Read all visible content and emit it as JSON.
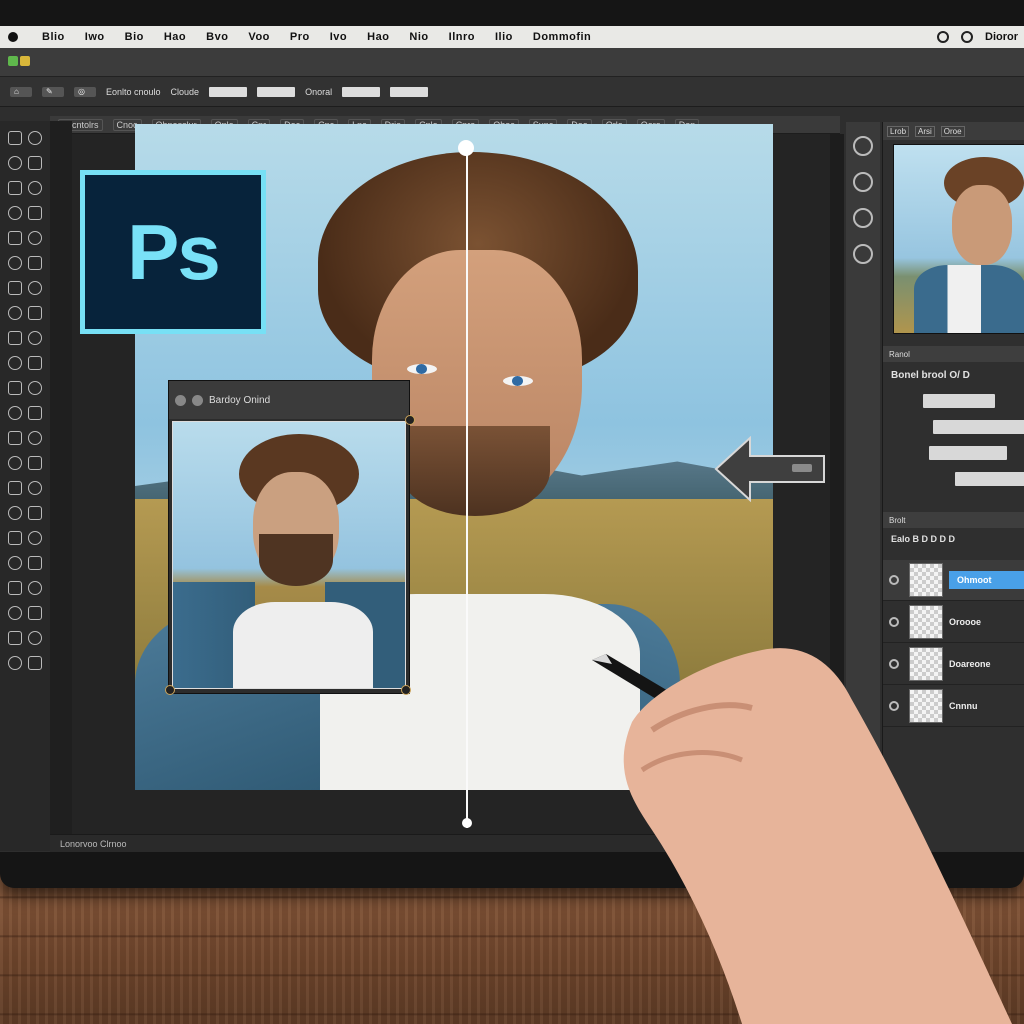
{
  "menubar": {
    "items": [
      "Blio",
      "Iwo",
      "Bio",
      "Hao",
      "Bvo",
      "Voo",
      "Pro",
      "Ivo",
      "Hao",
      "Nio",
      "Ilnro",
      "Ilio",
      "Dommofin"
    ],
    "status_text": "Dioror"
  },
  "toolbar": {
    "labels": [
      "Eonlto cnoulo",
      "Cloude",
      "Onoral"
    ]
  },
  "tabs": [
    "Lecntolrs",
    "Cnoc",
    "Ohnesslur",
    "Onlo",
    "Cnr",
    "Doc",
    "Cnc",
    "Lnc",
    "Drio",
    "Cnlo",
    "Cnre",
    "Ohoc",
    "Sunc",
    "Doe",
    "Orlo",
    "Ooro",
    "Don"
  ],
  "app": {
    "logo_text": "Ps"
  },
  "floating_window": {
    "title": "Bardoy Onind"
  },
  "right_panel": {
    "tabs": [
      "Lrob",
      "Arsi",
      "Oroe"
    ],
    "section1_label": "Ranol",
    "property_label": "Bonel  brool  O/ D",
    "layers_header": "Brolt",
    "layers_toolbar": "Ealo  B  D  D  D  D",
    "layers": [
      "Ohmoot",
      "Oroooe",
      "Doareone",
      "Cnnnu"
    ]
  },
  "statusbar": {
    "text": "Lonorvoo  Clrnoo"
  },
  "colors": {
    "accent": "#49a0e8",
    "logo_bg": "#07233b",
    "logo_fg": "#79e1f7"
  }
}
